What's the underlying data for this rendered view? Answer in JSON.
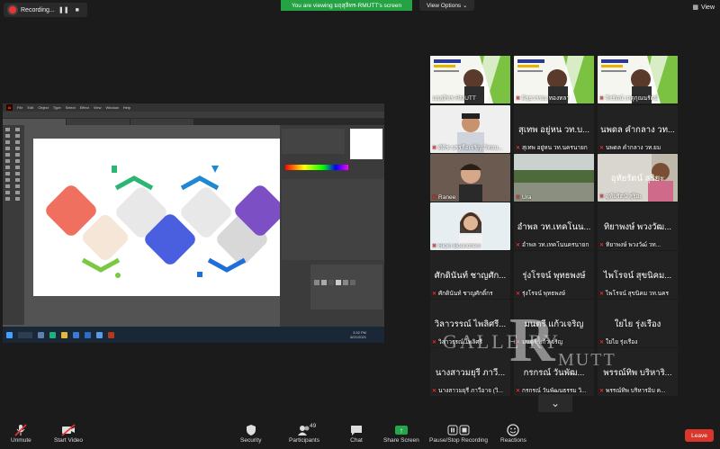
{
  "recording": {
    "label": "Recording..."
  },
  "banner": {
    "text": "You are viewing มฤสุลิทร-RMUTT's screen"
  },
  "view_options": {
    "label": "View Options ⌄"
  },
  "view": {
    "label": "View"
  },
  "participants": [
    {
      "big": "",
      "name": "มฤสุลิทร-RMUTT",
      "kind": "slide",
      "muted": false,
      "active": true
    },
    {
      "big": "",
      "name": "ผิรุธวรรณ ทองทลา",
      "kind": "slide",
      "muted": true
    },
    {
      "big": "",
      "name": "จิรรัตน์ เกตุกุณนรัตน์",
      "kind": "slide",
      "muted": true
    },
    {
      "big": "",
      "name": "ศิติช บรรลือเจริญ วิทยบ...",
      "kind": "face",
      "muted": true
    },
    {
      "big": "สุเทพ อยู่หน วท.บ...",
      "name": "สุเทพ อยู่หน วท.นครนายก",
      "kind": "text",
      "muted": true
    },
    {
      "big": "นพดล คำกลาง วท...",
      "name": "นพดล คำกลาง วท.ยม",
      "kind": "text",
      "muted": true
    },
    {
      "big": "",
      "name": "Ranee",
      "kind": "face2",
      "muted": true
    },
    {
      "big": "",
      "name": "Ura",
      "kind": "river",
      "muted": true
    },
    {
      "big": "อุทัยรัตน์ สุริยะ",
      "name": "อุทัยรัตน์ สุริยะ",
      "kind": "face3",
      "muted": true
    },
    {
      "big": "",
      "name": "Rioin Boonchem",
      "kind": "face4",
      "muted": true
    },
    {
      "big": "อำพล วท.เทคโนน...",
      "name": "อำพล วท.เทคโนนครนายก",
      "kind": "text",
      "muted": true
    },
    {
      "big": "ทิยาพงษ์ พวงวัฒ...",
      "name": "ทิยาพงษ์ พวงวัฒ์ วท...",
      "kind": "text",
      "muted": true
    },
    {
      "big": "ศักดินันท์ ชาญศัก...",
      "name": "ศักดินันท์ ชาญศักดิ์กร",
      "kind": "text",
      "muted": true
    },
    {
      "big": "รุ่งโรจน์ พุทธพงษ์",
      "name": "รุ่งโรจน์ พุทธพงษ์",
      "kind": "text",
      "muted": true
    },
    {
      "big": "ไพโรจน์ สุขนิคม...",
      "name": "ไพโรจน์ สุขนิคม วท.นคร",
      "kind": "text",
      "muted": true
    },
    {
      "big": "วิลาวรรณ์ ไพลิศรี...",
      "name": "วิลาวรรณ์ ไพลิศรี",
      "kind": "text",
      "muted": true
    },
    {
      "big": "มนตรี แก้วเจริญ",
      "name": "มนตรี แก้วเจริญ",
      "kind": "text",
      "muted": true
    },
    {
      "big": "ใยไย รุ่งเรือง",
      "name": "ใยไย รุ่งเรือง",
      "kind": "text",
      "muted": true
    },
    {
      "big": "นางสาวมยุรี ภาวี...",
      "name": "นางสาวมยุรี ภาวีอาจ (วิ...",
      "kind": "text",
      "muted": true
    },
    {
      "big": "กรกรณ์ วันพัฒ...",
      "name": "กรกรณ์ วันพัฒนธรรม วิ...",
      "kind": "text",
      "muted": true
    },
    {
      "big": "พรรณ์ทิพ บริหาริ...",
      "name": "พรรณ์ทิพ บริหารอิบ ค...",
      "kind": "text",
      "muted": true
    }
  ],
  "watermark": {
    "r": "R",
    "gallery": "GALLE   RY",
    "rmutt": "MUTT"
  },
  "toolbar": {
    "unmute": "Unmute",
    "start_video": "Start Video",
    "security": "Security",
    "participants": "Participants",
    "participants_count": "49",
    "chat": "Chat",
    "share_screen": "Share Screen",
    "pause_recording": "Pause/Stop Recording",
    "reactions": "Reactions",
    "leave": "Leave"
  },
  "shared_screen": {
    "menus": [
      "File",
      "Edit",
      "Object",
      "Type",
      "Select",
      "Effect",
      "View",
      "Window",
      "Help"
    ],
    "clock_time": "3:32 PM",
    "clock_date": "8/21/2021"
  }
}
